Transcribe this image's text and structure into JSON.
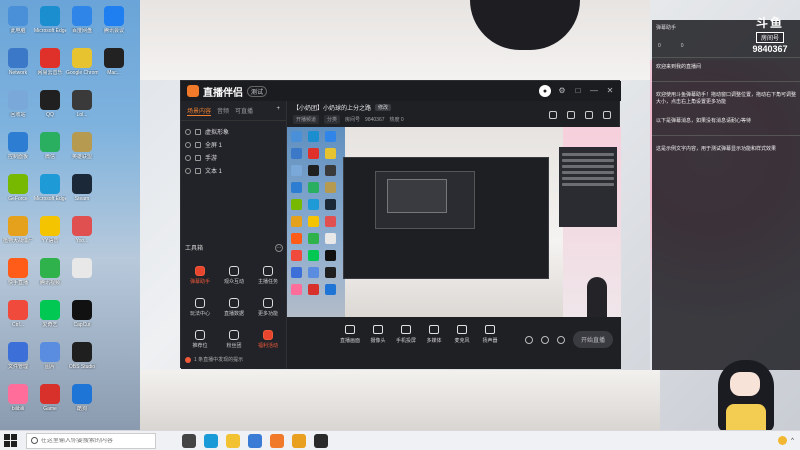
{
  "desktop": {
    "icons": [
      {
        "label": "此电脑",
        "color": "#4a90d9"
      },
      {
        "label": "Microsoft Edge",
        "color": "#1b8ed0"
      },
      {
        "label": "百度网盘",
        "color": "#2f86e8"
      },
      {
        "label": "腾讯会议",
        "color": "#1f7ef0"
      },
      {
        "label": "Network",
        "color": "#3c78c8"
      },
      {
        "label": "网易云音乐",
        "color": "#e0302a"
      },
      {
        "label": "Google Chrome",
        "color": "#e8c330"
      },
      {
        "label": "Mac...",
        "color": "#222222"
      },
      {
        "label": "回收站",
        "color": "#7aa8d8"
      },
      {
        "label": "QQ",
        "color": "#202020"
      },
      {
        "label": "Lol...",
        "color": "#3a3a3a"
      },
      {
        "label": "",
        "color": "#00000000"
      },
      {
        "label": "控制面板",
        "color": "#2d7dd2"
      },
      {
        "label": "微信",
        "color": "#2aae5f"
      },
      {
        "label": "英雄联盟",
        "color": "#b59a50"
      },
      {
        "label": "",
        "color": "#00000000"
      },
      {
        "label": "GeForce",
        "color": "#76b900"
      },
      {
        "label": "Microsoft Edge",
        "color": "#1e9ad6"
      },
      {
        "label": "Steam",
        "color": "#1b2838"
      },
      {
        "label": "",
        "color": "#00000000"
      },
      {
        "label": "植物大战僵尸",
        "color": "#e6a11c"
      },
      {
        "label": "YY语音",
        "color": "#f5c400"
      },
      {
        "label": "Yoo...",
        "color": "#e05050"
      },
      {
        "label": "",
        "color": "#00000000"
      },
      {
        "label": "快手直播",
        "color": "#ff5c1a"
      },
      {
        "label": "腾讯视频",
        "color": "#2fb24b"
      },
      {
        "label": "",
        "color": "#e8e8e8"
      },
      {
        "label": "",
        "color": "#00000000"
      },
      {
        "label": "Ctrl...",
        "color": "#ef4a3c"
      },
      {
        "label": "爱奇艺",
        "color": "#00c853"
      },
      {
        "label": "CapCut",
        "color": "#111111"
      },
      {
        "label": "",
        "color": "#00000000"
      },
      {
        "label": "文件管理",
        "color": "#3d6fd8"
      },
      {
        "label": "图片",
        "color": "#5a8de0"
      },
      {
        "label": "OBS Studio",
        "color": "#1f1f1f"
      },
      {
        "label": "",
        "color": "#00000000"
      },
      {
        "label": "bilibili",
        "color": "#ff6d9a"
      },
      {
        "label": "Game",
        "color": "#d8302a"
      },
      {
        "label": "酷狗",
        "color": "#1f75d6"
      },
      {
        "label": "",
        "color": "#00000000"
      }
    ]
  },
  "app": {
    "name": "直播伴侣",
    "version_badge": "测试",
    "avatar_letter": "●",
    "scene_tabs": [
      "场景内容",
      "音频",
      "可直播"
    ],
    "add_tab": "+",
    "sources": [
      "虚拟形象",
      "全屏 1",
      "手游",
      "文本 1"
    ],
    "tools_title": "工具箱",
    "tools_more": "···",
    "tools": [
      {
        "label": "弹幕助手",
        "hot": true
      },
      {
        "label": "观众互动",
        "hot": false
      },
      {
        "label": "主播任务",
        "hot": false
      },
      {
        "label": "玩法中心",
        "hot": false
      },
      {
        "label": "直播数据",
        "hot": false
      },
      {
        "label": "更多功能",
        "hot": false
      },
      {
        "label": "推荐位",
        "hot": false
      },
      {
        "label": "粉丝团",
        "hot": false
      },
      {
        "label": "福利活动",
        "hot": true
      }
    ],
    "footer_text": "1 条直播中发现的提示",
    "room": {
      "title": "【小奶团】小奶球的上分之路",
      "edit_tag": "修改",
      "info_items": [
        "开播频道",
        "分类",
        "房间号",
        "9840367",
        "热度 0"
      ]
    },
    "bottom_tools": [
      "直播画面",
      "摄像头",
      "手机投屏",
      "多媒体",
      "麦克风",
      "扬声器"
    ],
    "start_button": "开始直播",
    "window_buttons": [
      "□",
      "—",
      "✕"
    ]
  },
  "overlay": {
    "panel_title": "弹幕助手",
    "stats": [
      "0",
      "0"
    ],
    "messages": [
      "欢迎来到我的直播间",
      "欢迎使用斗鱼弹幕助手！拖动窗口调整位置，拖动右下角可调整大小，点击右上角设置更多功能",
      "以下是弹幕消息，如果没有消息请耐心等待",
      "这是示例文字内容，用于测试弹幕显示功能和样式效果"
    ],
    "brand_logo": "斗鱼",
    "brand_tag": "房间号",
    "room_number": "9840367"
  },
  "taskbar": {
    "search_placeholder": "在这里输入你要搜索的内容",
    "apps": [
      {
        "name": "task-view",
        "color": "#444444"
      },
      {
        "name": "edge",
        "color": "#1a9bd7"
      },
      {
        "name": "file-explorer",
        "color": "#f2c233"
      },
      {
        "name": "store",
        "color": "#3a7bd5"
      },
      {
        "name": "live-companion",
        "color": "#f07a2a"
      },
      {
        "name": "game",
        "color": "#e9a020"
      },
      {
        "name": "obs",
        "color": "#2a2a2a"
      }
    ],
    "tray_text": "^"
  }
}
